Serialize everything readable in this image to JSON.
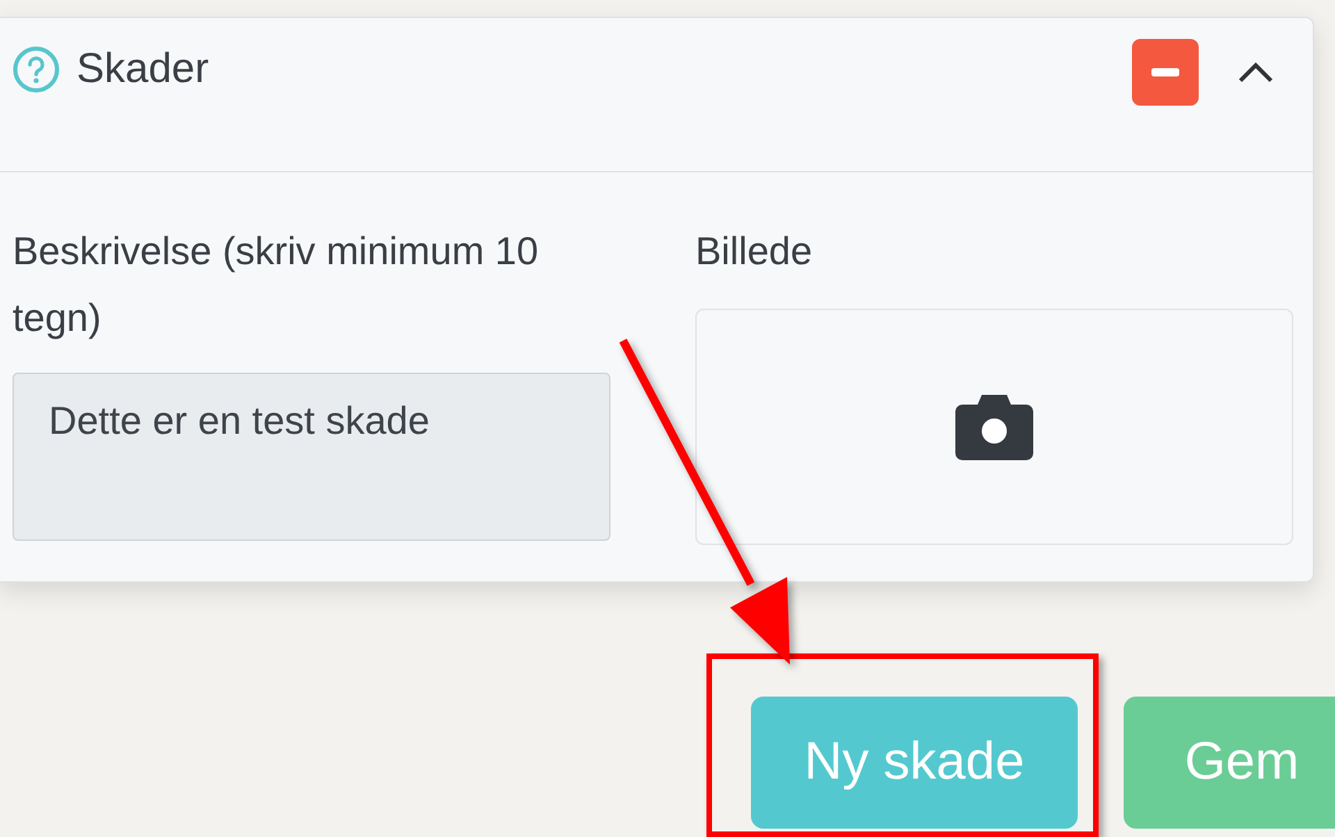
{
  "panel": {
    "title": "Skader",
    "expanded": true
  },
  "description": {
    "label": "Beskrivelse (skriv minimum 10 tegn)",
    "value": "Dette er en test skade",
    "disabled": true
  },
  "image": {
    "label": "Billede"
  },
  "buttons": [
    {
      "label": "Ny skade",
      "kind": "info"
    },
    {
      "label": "Gem",
      "kind": "success"
    }
  ]
}
